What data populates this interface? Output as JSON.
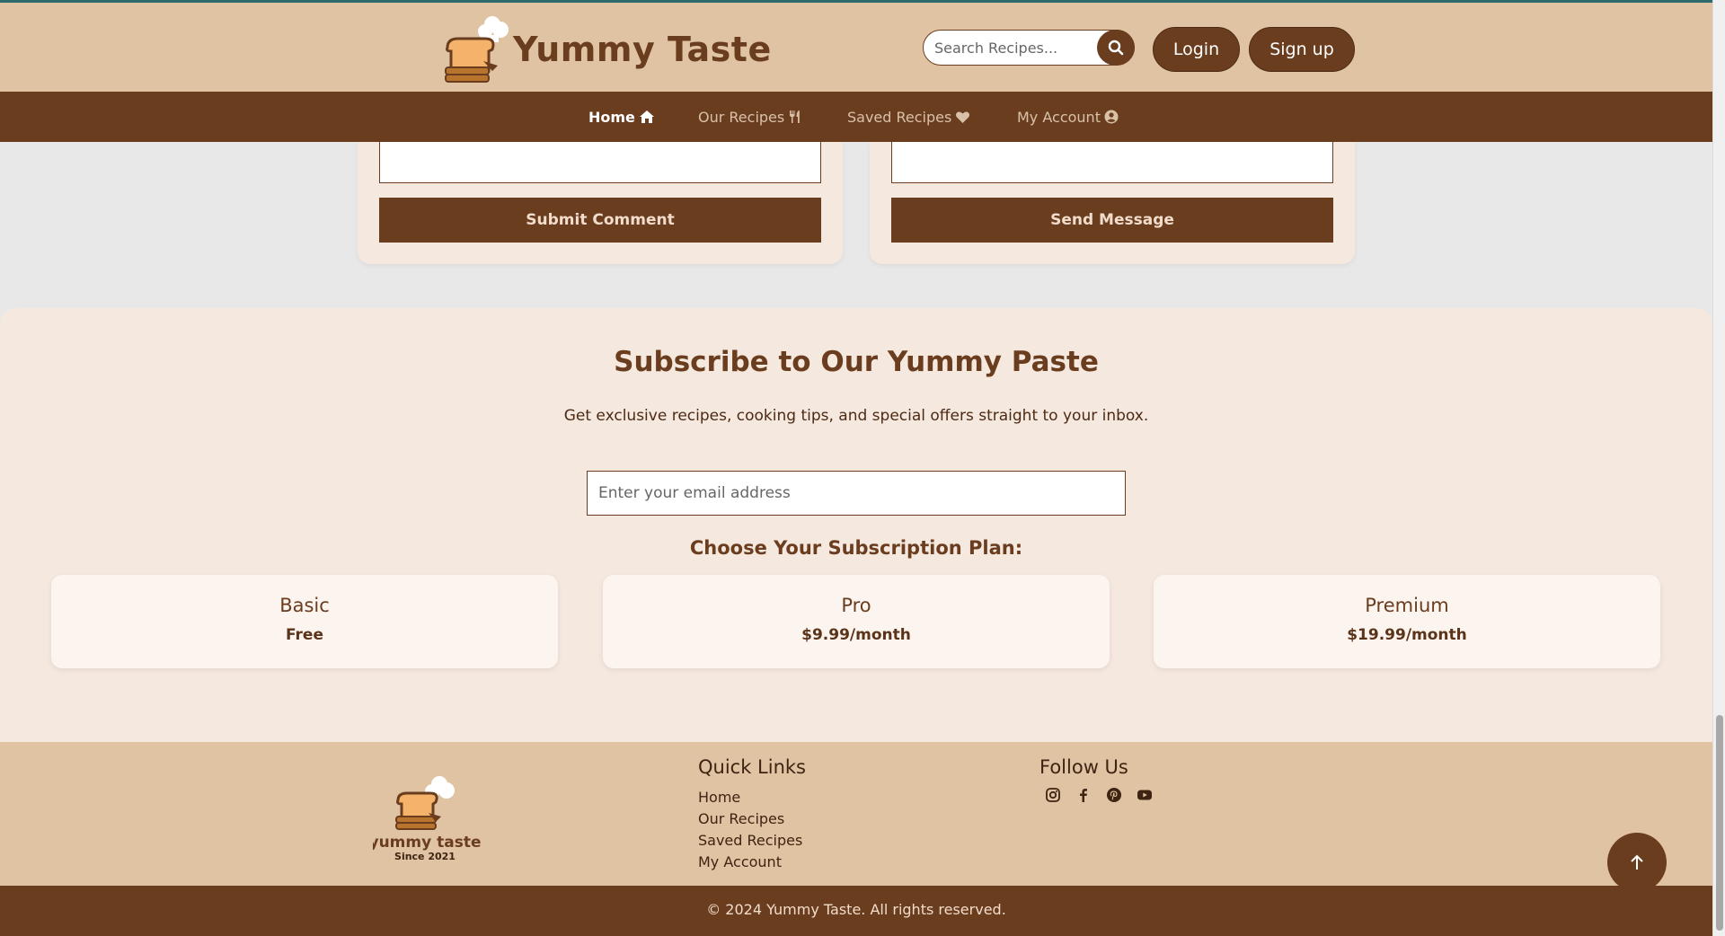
{
  "header": {
    "brand": "Yummy Taste",
    "search_placeholder": "Search Recipes...",
    "login_label": "Login",
    "signup_label": "Sign up"
  },
  "nav": {
    "items": [
      {
        "label": "Home",
        "icon": "home-icon",
        "active": true
      },
      {
        "label": "Our Recipes",
        "icon": "utensils-icon",
        "active": false
      },
      {
        "label": "Saved Recipes",
        "icon": "heart-icon",
        "active": false
      },
      {
        "label": "My Account",
        "icon": "user-circle-icon",
        "active": false
      }
    ]
  },
  "forms": {
    "comment_button": "Submit Comment",
    "message_button": "Send Message"
  },
  "subscribe": {
    "title": "Subscribe to Our Yummy Paste",
    "text": "Get exclusive recipes, cooking tips, and special offers straight to your inbox.",
    "email_placeholder": "Enter your email address",
    "plans_title": "Choose Your Subscription Plan:",
    "plans": [
      {
        "name": "Basic",
        "price": "Free"
      },
      {
        "name": "Pro",
        "price": "$9.99/month"
      },
      {
        "name": "Premium",
        "price": "$19.99/month"
      }
    ]
  },
  "footer": {
    "logo_text": "yummy taste",
    "logo_subtext": "Since 2021",
    "quick_links_title": "Quick Links",
    "quick_links": [
      "Home",
      "Our Recipes",
      "Saved Recipes",
      "My Account"
    ],
    "follow_title": "Follow Us",
    "social": [
      "instagram-icon",
      "facebook-icon",
      "pinterest-icon",
      "youtube-icon"
    ],
    "copyright": "© 2024 Yummy Taste. All rights reserved."
  },
  "colors": {
    "brand_brown": "#6a3d1f",
    "header_tan": "#dfc3a2",
    "section_cream": "#f5e8df"
  }
}
